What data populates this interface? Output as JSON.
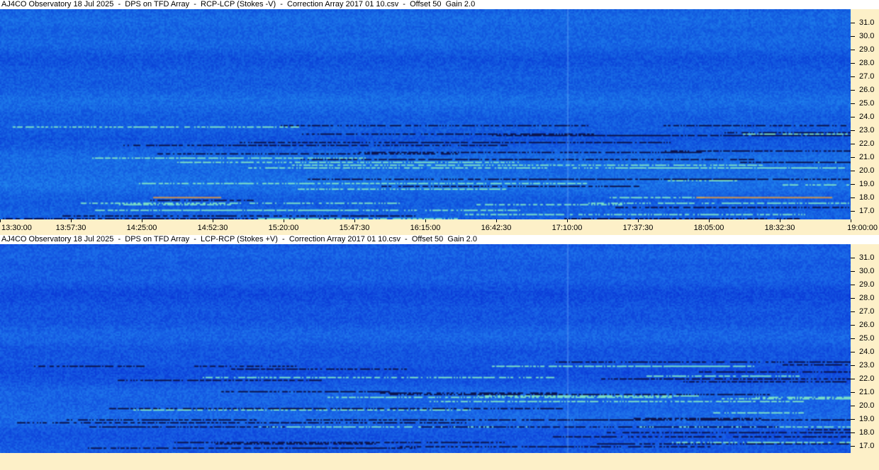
{
  "top_panel": {
    "title": "AJ4CO Observatory 18 Jul 2025  -  DPS on TFD Array  -  RCP-LCP (Stokes -V)  -  Correction Array 2017 01 10.csv  -  Offset 50  Gain 2.0"
  },
  "bottom_panel": {
    "title": "AJ4CO Observatory 18 Jul 2025  -  DPS on TFD Array  -  LCP-RCP (Stokes +V)  -  Correction Array 2017 01 10.csv  -  Offset 50  Gain 2.0"
  },
  "frequency_labels": [
    "31.0",
    "30.0",
    "29.0",
    "28.0",
    "27.0",
    "26.0",
    "25.0",
    "24.0",
    "23.0",
    "22.0",
    "21.0",
    "20.0",
    "19.0",
    "18.0",
    "17.0"
  ],
  "time_labels": [
    "13:30:00",
    "13:57:30",
    "14:25:00",
    "14:52:30",
    "15:20:00",
    "15:47:30",
    "16:15:00",
    "16:42:30",
    "17:10:00",
    "17:37:30",
    "18:05:00",
    "18:32:30",
    "19:00:00"
  ],
  "colors": {
    "background": "#fdf0c8",
    "spectrogram_base": "#1a5fe0",
    "title_bar": "#ffffff"
  }
}
